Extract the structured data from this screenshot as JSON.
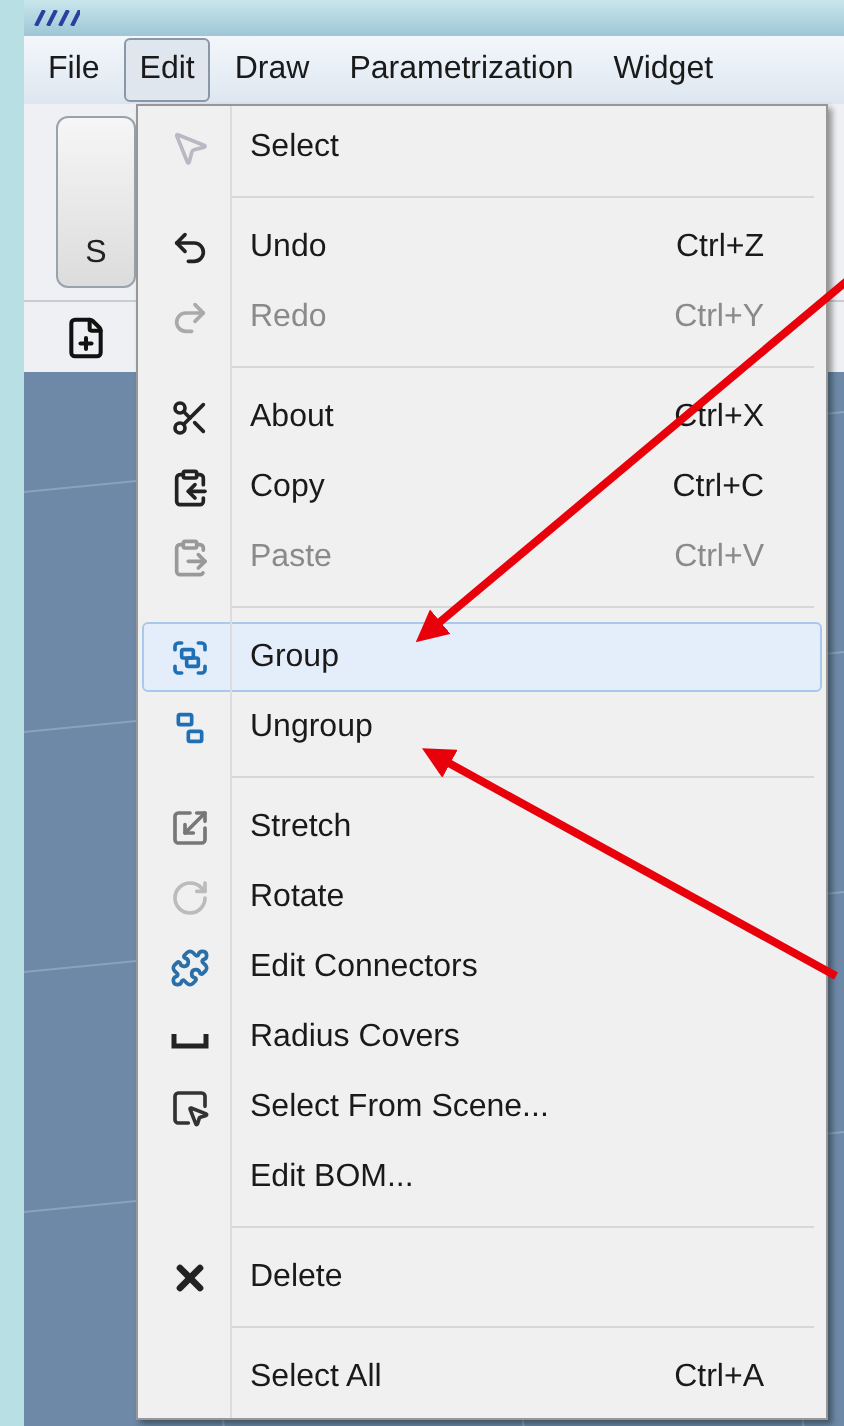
{
  "menubar": [
    {
      "label": "File",
      "selected": false
    },
    {
      "label": "Edit",
      "selected": true
    },
    {
      "label": "Draw",
      "selected": false
    },
    {
      "label": "Parametrization",
      "selected": false
    },
    {
      "label": "Widget",
      "selected": false
    }
  ],
  "toolbar": {
    "button_label": "S"
  },
  "menu": {
    "items": [
      {
        "kind": "item",
        "label": "Select",
        "disabled": false,
        "selected": false
      },
      {
        "kind": "separator"
      },
      {
        "kind": "item",
        "label": "Undo",
        "shortcut": "Ctrl+Z",
        "disabled": false,
        "selected": false
      },
      {
        "kind": "item",
        "label": "Redo",
        "shortcut": "Ctrl+Y",
        "disabled": true,
        "selected": false
      },
      {
        "kind": "separator"
      },
      {
        "kind": "item",
        "label": "About",
        "shortcut": "Ctrl+X",
        "disabled": false,
        "selected": false
      },
      {
        "kind": "item",
        "label": "Copy",
        "shortcut": "Ctrl+C",
        "disabled": false,
        "selected": false
      },
      {
        "kind": "item",
        "label": "Paste",
        "shortcut": "Ctrl+V",
        "disabled": true,
        "selected": false
      },
      {
        "kind": "separator"
      },
      {
        "kind": "item",
        "label": "Group",
        "disabled": false,
        "selected": true
      },
      {
        "kind": "item",
        "label": "Ungroup",
        "disabled": false,
        "selected": false
      },
      {
        "kind": "separator"
      },
      {
        "kind": "item",
        "label": "Stretch",
        "disabled": false,
        "selected": false
      },
      {
        "kind": "item",
        "label": "Rotate",
        "disabled": false,
        "selected": false
      },
      {
        "kind": "item",
        "label": "Edit Connectors",
        "disabled": false,
        "selected": false
      },
      {
        "kind": "item",
        "label": "Radius Covers",
        "disabled": false,
        "selected": false
      },
      {
        "kind": "item",
        "label": "Select From Scene...",
        "disabled": false,
        "selected": false
      },
      {
        "kind": "item",
        "label": "Edit BOM...",
        "disabled": false,
        "selected": false
      },
      {
        "kind": "separator"
      },
      {
        "kind": "item",
        "label": "Delete",
        "disabled": false,
        "selected": false
      },
      {
        "kind": "separator"
      },
      {
        "kind": "item",
        "label": "Select All",
        "shortcut": "Ctrl+A",
        "disabled": false,
        "selected": false
      }
    ]
  }
}
